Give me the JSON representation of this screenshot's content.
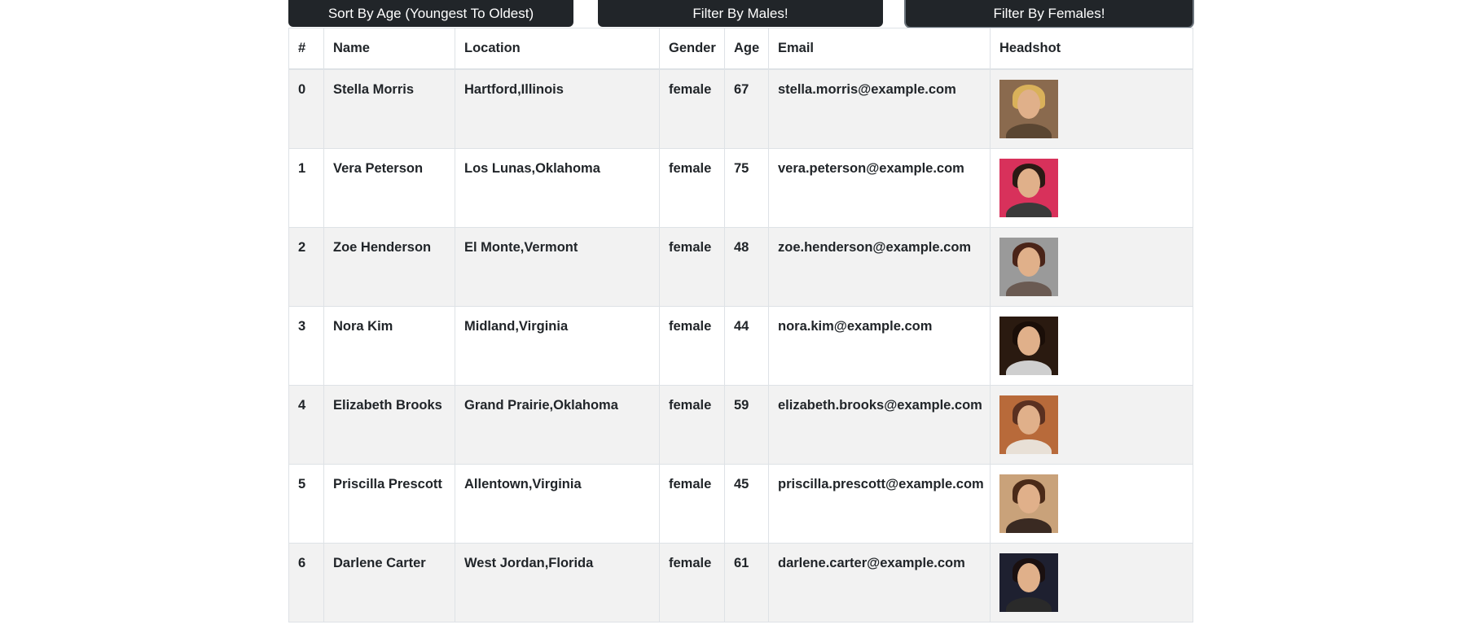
{
  "buttons": {
    "sort_label": "Sort By Age (Youngest To Oldest)",
    "males_label": "Filter By Males!",
    "females_label": "Filter By Females!"
  },
  "table": {
    "headers": [
      "#",
      "Name",
      "Location",
      "Gender",
      "Age",
      "Email",
      "Headshot"
    ],
    "rows": [
      {
        "index": "0",
        "name": "Stella Morris",
        "location": "Hartford,Illinois",
        "gender": "female",
        "age": "67",
        "email": "stella.morris@example.com",
        "photo": {
          "bg": "#8a6a4e",
          "hair": "#d9b15a",
          "shirt": "#5a4632"
        }
      },
      {
        "index": "1",
        "name": "Vera Peterson",
        "location": "Los Lunas,Oklahoma",
        "gender": "female",
        "age": "75",
        "email": "vera.peterson@example.com",
        "photo": {
          "bg": "#d8315b",
          "hair": "#2a1a14",
          "shirt": "#3a3a3a"
        }
      },
      {
        "index": "2",
        "name": "Zoe Henderson",
        "location": "El Monte,Vermont",
        "gender": "female",
        "age": "48",
        "email": "zoe.henderson@example.com",
        "photo": {
          "bg": "#9a9a9a",
          "hair": "#4a2418",
          "shirt": "#6a5a52"
        }
      },
      {
        "index": "3",
        "name": "Nora Kim",
        "location": "Midland,Virginia",
        "gender": "female",
        "age": "44",
        "email": "nora.kim@example.com",
        "photo": {
          "bg": "#2a1a10",
          "hair": "#1a0e08",
          "shirt": "#cfcfcf"
        }
      },
      {
        "index": "4",
        "name": "Elizabeth Brooks",
        "location": "Grand Prairie,Oklahoma",
        "gender": "female",
        "age": "59",
        "email": "elizabeth.brooks@example.com",
        "photo": {
          "bg": "#b86a3a",
          "hair": "#5a3020",
          "shirt": "#e8e0d6"
        }
      },
      {
        "index": "5",
        "name": "Priscilla Prescott",
        "location": "Allentown,Virginia",
        "gender": "female",
        "age": "45",
        "email": "priscilla.prescott@example.com",
        "photo": {
          "bg": "#c9a27a",
          "hair": "#4a2a18",
          "shirt": "#3a2a22"
        }
      },
      {
        "index": "6",
        "name": "Darlene Carter",
        "location": "West Jordan,Florida",
        "gender": "female",
        "age": "61",
        "email": "darlene.carter@example.com",
        "photo": {
          "bg": "#1e2030",
          "hair": "#1a1010",
          "shirt": "#2a2a2a"
        }
      }
    ]
  },
  "colors": {
    "button_bg": "#212529",
    "button_text": "#ffffff",
    "stripe": "#f2f2f2",
    "border": "#dee2e6"
  }
}
